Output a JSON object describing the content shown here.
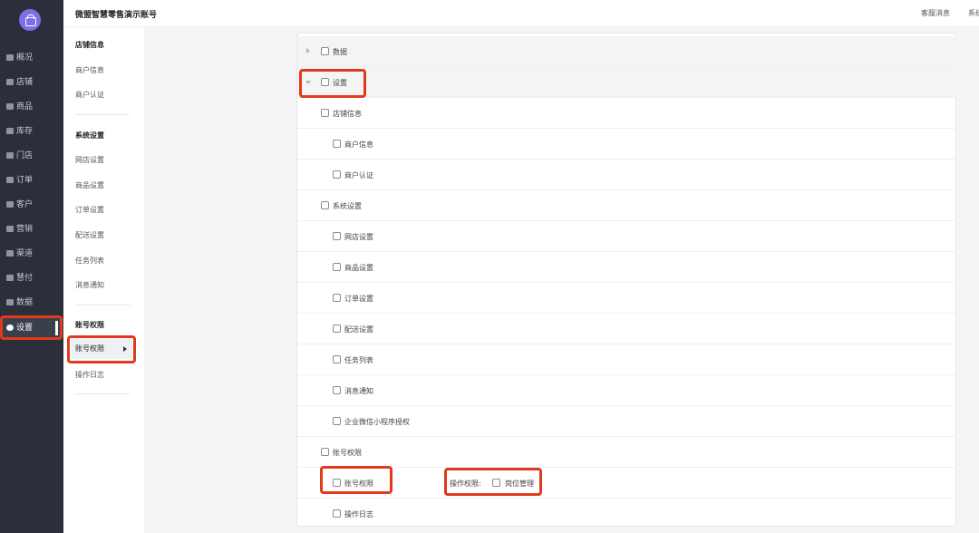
{
  "top": {
    "title": "微盟智慧零售演示账号",
    "links": [
      "客服消息",
      "系统"
    ]
  },
  "nav": {
    "items": [
      {
        "label": "概况",
        "icon": "overview-icon"
      },
      {
        "label": "店铺",
        "icon": "store-icon"
      },
      {
        "label": "商品",
        "icon": "goods-icon"
      },
      {
        "label": "库存",
        "icon": "inventory-icon"
      },
      {
        "label": "门店",
        "icon": "shop-icon"
      },
      {
        "label": "订单",
        "icon": "order-icon"
      },
      {
        "label": "客户",
        "icon": "customer-icon"
      },
      {
        "label": "营销",
        "icon": "marketing-icon"
      },
      {
        "label": "渠道",
        "icon": "channel-icon"
      },
      {
        "label": "慧付",
        "icon": "pay-icon"
      },
      {
        "label": "数据",
        "icon": "data-icon"
      },
      {
        "label": "设置",
        "icon": "settings-icon"
      }
    ],
    "active_index": 11
  },
  "sub": {
    "groups": [
      {
        "head": "店铺信息",
        "items": [
          "商户信息",
          "商户认证"
        ]
      },
      {
        "head": "系统设置",
        "items": [
          "网店设置",
          "商品设置",
          "订单设置",
          "配送设置",
          "任务列表",
          "消息通知"
        ]
      },
      {
        "head": "账号权限",
        "items": [
          "账号权限",
          "操作日志"
        ]
      }
    ],
    "active": "账号权限"
  },
  "tree": {
    "data": "数据",
    "settings": "设置",
    "store_info": "店铺信息",
    "merchant_info": "商户信息",
    "merchant_auth": "商户认证",
    "system": "系统设置",
    "web_store": "网店设置",
    "goods": "商品设置",
    "order": "订单设置",
    "delivery": "配送设置",
    "tasks": "任务列表",
    "notify": "消息通知",
    "wechat": "企业微信小程序授权",
    "account": "账号权限",
    "account_sub": "账号权限",
    "op_perm_label": "操作权限:",
    "post_mgmt": "岗位管理",
    "op_log": "操作日志"
  },
  "colors": {
    "accent": "#7f6ee6",
    "highlight": "#e0391c",
    "sidebar": "#2a2f3b"
  }
}
